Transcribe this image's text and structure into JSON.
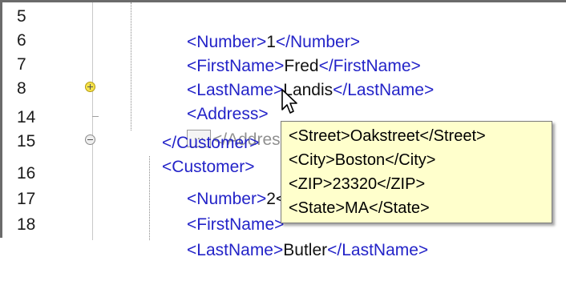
{
  "editor": {
    "lines": [
      {
        "num": "5",
        "open": "<Number>",
        "value": "1",
        "close": "</Number>"
      },
      {
        "num": "6",
        "open": "<FirstName>",
        "value": "Fred",
        "close": "</FirstName>"
      },
      {
        "num": "7",
        "open": "<LastName>",
        "value": "Landis",
        "close": "</LastName>"
      },
      {
        "num": "8",
        "open": "<Address>",
        "value": "...",
        "close": "</Address>"
      },
      {
        "num": "14",
        "open": "</Customer>",
        "value": "",
        "close": ""
      },
      {
        "num": "15",
        "open": "<Customer>",
        "value": "",
        "close": ""
      },
      {
        "num": "16",
        "open": "<Number>",
        "value": "2<",
        "close": ""
      },
      {
        "num": "17",
        "open": "<FirstName>",
        "value": "",
        "close": ""
      },
      {
        "num": "18",
        "open": "<LastName>",
        "value": "Butler",
        "close": "</LastName>"
      }
    ]
  },
  "tooltip": {
    "lines": [
      "<Street>Oakstreet</Street>",
      "<City>Boston</City>",
      "<ZIP>23320</ZIP>",
      "<State>MA</State>"
    ]
  },
  "icons": {
    "expand": "plus-circle-icon",
    "collapse": "minus-circle-icon",
    "cursor": "arrow-cursor-icon"
  },
  "colors": {
    "tag": "#2323c8",
    "text": "#111111",
    "tooltip_bg": "#ffffcc",
    "fold_expand": "#f6e24a"
  }
}
